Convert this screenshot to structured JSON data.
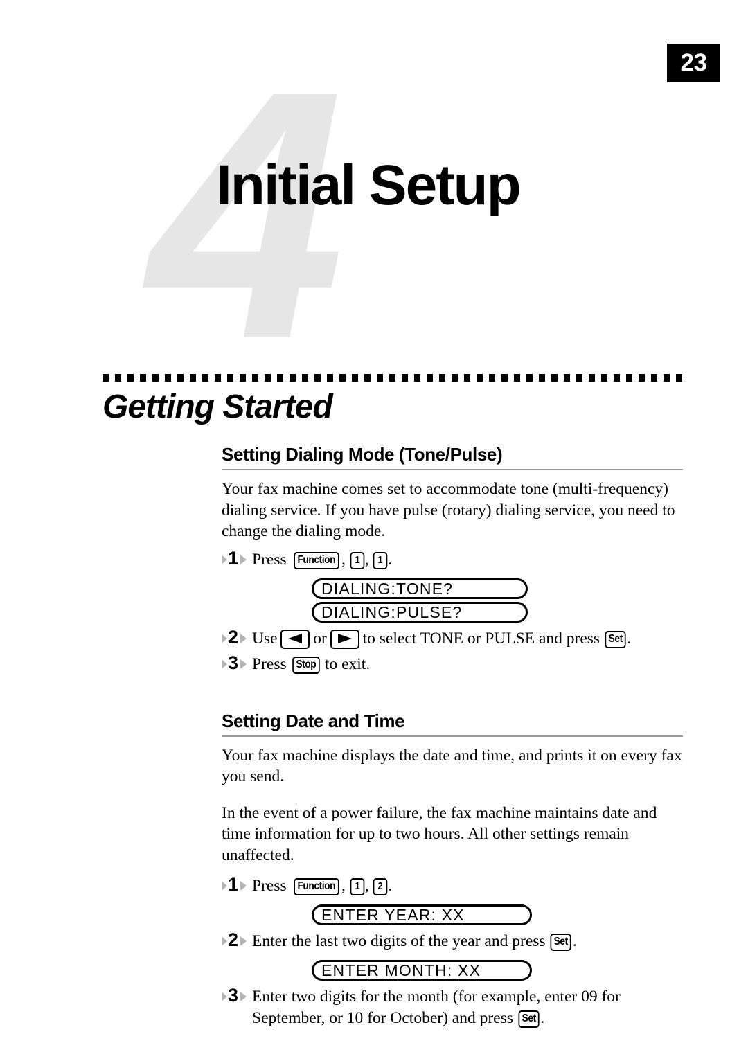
{
  "page": {
    "number": "23"
  },
  "chapter": {
    "number_watermark": "4",
    "title": "Initial Setup"
  },
  "part": {
    "title": "Getting Started"
  },
  "sections": [
    {
      "heading": "Setting Dialing Mode (Tone/Pulse)",
      "paragraphs": [
        "Your fax machine comes set to accommodate tone (multi-frequency) dialing service. If you have pulse (rotary) dialing service, you need to change the dialing mode."
      ],
      "steps": [
        {
          "number": "1",
          "text_before": "Press ",
          "keys": [
            "Function",
            "1",
            "1"
          ],
          "text_after": "."
        },
        {
          "number": "2",
          "text_lead": "Use ",
          "text_mid": " or ",
          "text_tail": " to select TONE or PULSE and press ",
          "set_key": "Set",
          "text_end": "."
        },
        {
          "number": "3",
          "text_before": "Press ",
          "stop_key": "Stop",
          "text_after": " to exit."
        }
      ],
      "lcd_messages": [
        "DIALING:TONE?",
        "DIALING:PULSE?"
      ]
    },
    {
      "heading": "Setting Date and Time",
      "paragraphs": [
        "Your fax machine displays the date and time, and prints it on every fax you send.",
        "In the event of a power failure, the fax machine maintains date and time information for up to two hours. All other settings remain unaffected."
      ],
      "steps": [
        {
          "number": "1",
          "text_before": "Press ",
          "keys": [
            "Function",
            "1",
            "2"
          ],
          "text_after": "."
        },
        {
          "number": "2",
          "text_before": "Enter the last two digits of the year and press ",
          "set_key": "Set",
          "text_after": "."
        },
        {
          "number": "3",
          "text_before": "Enter two digits for the month (for example, enter 09 for September, or 10 for October) and press ",
          "set_key": "Set",
          "text_after": "."
        }
      ],
      "lcd_messages": [
        "ENTER YEAR: XX",
        "ENTER MONTH: XX"
      ]
    }
  ],
  "icons": {
    "arrow_left": "arrow-left-icon",
    "arrow_right": "arrow-right-icon",
    "step_marker": "step-arrow-marker-icon"
  },
  "colors": {
    "text": "#000000",
    "watermark": "#e6e6e6",
    "rule": "#9a9a9a",
    "step_marker_arrow": "#b4b4b4",
    "badge_bg": "#000000",
    "badge_text": "#ffffff"
  }
}
